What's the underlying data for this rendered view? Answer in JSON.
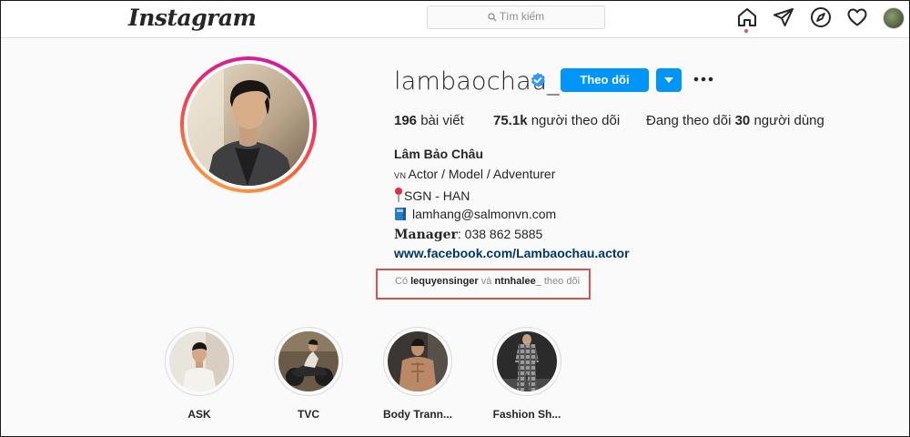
{
  "header": {
    "logo": "Instagram",
    "search_placeholder": "Tìm kiếm",
    "nav_icons": [
      "home-icon",
      "direct-icon",
      "explore-icon",
      "activity-icon",
      "profile-avatar"
    ]
  },
  "profile": {
    "username": "lambaochau_",
    "follow_label": "Theo dõi",
    "stats": {
      "posts_count": "196",
      "posts_label": "bài viết",
      "followers_count": "75.1k",
      "followers_label": "người theo dõi",
      "following_prefix": "Đang theo dõi",
      "following_count": "30",
      "following_suffix": "người dùng"
    },
    "full_name": "Lâm Bảo Châu",
    "bio": {
      "line1_flag": "vn",
      "line1": "Actor / Model / Adventurer",
      "line2": "SGN - HAN",
      "line3": "lamhang@salmonvn.com",
      "manager_label": "Manager",
      "manager_value": ": 038 862 5885"
    },
    "website": "www.facebook.com/Lambaochau.actor",
    "followed_by": {
      "prefix": "Có",
      "user1": "lequyensinger",
      "connector": "và",
      "user2": "ntnhalee_",
      "suffix": "theo dõi"
    }
  },
  "highlights": [
    {
      "label": "ASK"
    },
    {
      "label": "TVC"
    },
    {
      "label": "Body Trann..."
    },
    {
      "label": "Fashion Sh..."
    }
  ],
  "colors": {
    "accent": "#0095f6",
    "link": "#00376b",
    "annotation_box": "#d9534f",
    "notification_dot": "#ed4956"
  }
}
